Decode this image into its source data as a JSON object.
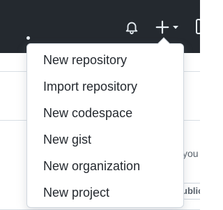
{
  "header": {
    "notifications_icon": "bell-icon",
    "create_icon": "plus-icon",
    "create_caret_icon": "caret-down-icon"
  },
  "background": {
    "partial_text": "you",
    "partial_badge": "ublic"
  },
  "create_menu": {
    "items": [
      {
        "label": "New repository"
      },
      {
        "label": "Import repository"
      },
      {
        "label": "New codespace"
      },
      {
        "label": "New gist"
      },
      {
        "label": "New organization"
      },
      {
        "label": "New project"
      }
    ]
  }
}
